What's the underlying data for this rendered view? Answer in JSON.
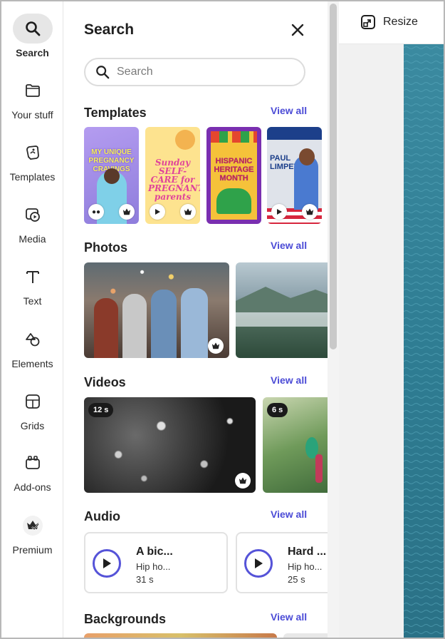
{
  "rail": [
    {
      "label": "Search",
      "icon": "search-icon",
      "active": true
    },
    {
      "label": "Your stuff",
      "icon": "folder-icon"
    },
    {
      "label": "Templates",
      "icon": "templates-icon"
    },
    {
      "label": "Media",
      "icon": "media-icon"
    },
    {
      "label": "Text",
      "icon": "text-icon"
    },
    {
      "label": "Elements",
      "icon": "elements-icon"
    },
    {
      "label": "Grids",
      "icon": "grids-icon"
    },
    {
      "label": "Add-ons",
      "icon": "add-ons-icon"
    },
    {
      "label": "Premium",
      "icon": "premium-crown-icon"
    }
  ],
  "panel": {
    "title": "Search",
    "search_placeholder": "Search",
    "view_all": "View all"
  },
  "sections": {
    "templates": "Templates",
    "photos": "Photos",
    "videos": "Videos",
    "audio": "Audio",
    "backgrounds": "Backgrounds"
  },
  "templates": [
    {
      "text": "MY UNIQUE PREGNANCY CRAVINGS",
      "bg": "#a98fe0"
    },
    {
      "text": "Sunday SELF-CARE for PREGNANT parents",
      "bg": "#fbe08a"
    },
    {
      "text": "HISPANIC HERITAGE MONTH",
      "bg": "#7a2fb0"
    },
    {
      "text": "PAUL LIMPET",
      "bg": "#dfe3ea"
    }
  ],
  "videos": [
    {
      "duration": "12 s"
    },
    {
      "duration": "6 s"
    }
  ],
  "audio": [
    {
      "title": "A bic...",
      "genre": "Hip ho...",
      "duration": "31 s"
    },
    {
      "title": "Hard ...",
      "genre": "Hip ho...",
      "duration": "25 s"
    }
  ],
  "topbar": {
    "resize": "Resize"
  },
  "colors": {
    "accent": "#4b4bd6",
    "play": "#5553d8",
    "ocean": "#3f8ea3"
  }
}
